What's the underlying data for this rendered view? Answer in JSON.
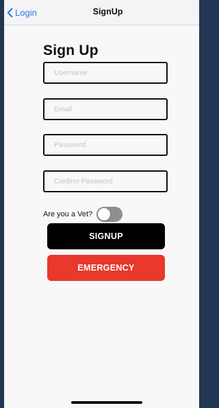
{
  "nav": {
    "back_label": "Login",
    "title": "SignUp"
  },
  "form": {
    "heading": "Sign Up",
    "username_placeholder": "Username",
    "email_placeholder": "Email",
    "password_placeholder": "Password",
    "confirm_placeholder": "Confirm Password",
    "vet_label": "Are you a Vet?",
    "vet_toggle_on": false,
    "signup_label": "SIGNUP",
    "emergency_label": "EMERGENCY"
  },
  "colors": {
    "back_link": "#2f7ae5",
    "signup_button": "#000000",
    "emergency_button": "#e8392c",
    "toggle_off": "#8e8e93",
    "outer_background": "#233754"
  },
  "icons": {
    "back": "chevron-left-icon"
  }
}
